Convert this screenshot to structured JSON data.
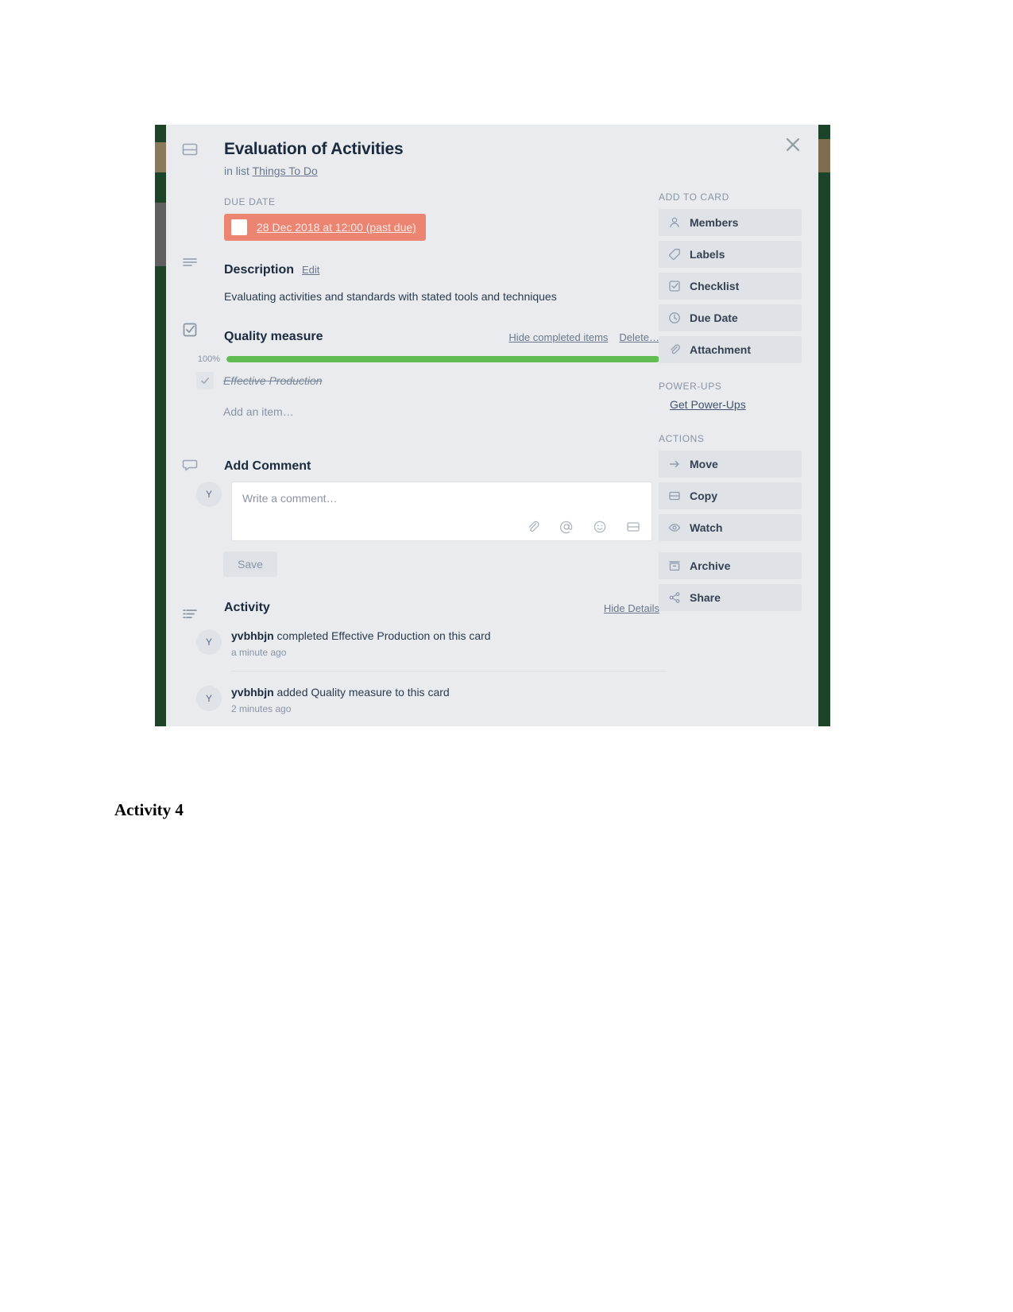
{
  "card": {
    "title": "Evaluation of Activities",
    "in_list_prefix": "in list",
    "list_name": "Things To Do",
    "close_icon": "close-icon",
    "card_icon": "card-icon"
  },
  "due_date": {
    "label": "DUE DATE",
    "value": "28 Dec 2018 at 12:00 (past due)",
    "pill_color": "#eb8572",
    "checkbox_checked": false
  },
  "description": {
    "heading": "Description",
    "edit_label": "Edit",
    "body": "Evaluating activities and standards with stated tools and techniques",
    "icon": "description-lines-icon"
  },
  "checklist": {
    "heading": "Quality measure",
    "icon": "checklist-icon",
    "hide_completed_label": "Hide completed items",
    "delete_label": "Delete…",
    "percent_label": "100%",
    "percent_value": 100,
    "bar_color": "#61bd4f",
    "items": [
      {
        "text": "Effective Production",
        "checked": true
      }
    ],
    "add_item_placeholder": "Add an item…"
  },
  "comment": {
    "heading": "Add Comment",
    "icon": "comment-bubble-icon",
    "avatar_initial": "Y",
    "placeholder": "Write a comment…",
    "save_label": "Save",
    "tools": [
      "attachment-icon",
      "mention-icon",
      "emoji-icon",
      "card-icon"
    ]
  },
  "activity": {
    "heading": "Activity",
    "icon": "activity-list-icon",
    "hide_details_label": "Hide Details",
    "entries": [
      {
        "avatar_initial": "Y",
        "user": "yvbhbjn",
        "action": " completed Effective Production on this card",
        "time": "a minute ago"
      },
      {
        "avatar_initial": "Y",
        "user": "yvbhbjn",
        "action": " added Quality measure to this card",
        "time": "2 minutes ago"
      }
    ]
  },
  "sidebar": {
    "add_to_card_label": "ADD TO CARD",
    "add_to_card_items": [
      {
        "label": "Members",
        "icon": "person-icon"
      },
      {
        "label": "Labels",
        "icon": "tag-icon"
      },
      {
        "label": "Checklist",
        "icon": "checklist-icon"
      },
      {
        "label": "Due Date",
        "icon": "clock-icon"
      },
      {
        "label": "Attachment",
        "icon": "attachment-icon"
      }
    ],
    "powerups_label": "POWER-UPS",
    "powerups_link": "Get Power-Ups",
    "actions_label": "ACTIONS",
    "action_items": [
      {
        "label": "Move",
        "icon": "arrow-right-icon"
      },
      {
        "label": "Copy",
        "icon": "card-icon"
      },
      {
        "label": "Watch",
        "icon": "eye-icon"
      },
      {
        "label": "Archive",
        "icon": "archive-box-icon"
      },
      {
        "label": "Share",
        "icon": "share-icon"
      }
    ]
  },
  "document": {
    "footer_heading": "Activity 4"
  }
}
